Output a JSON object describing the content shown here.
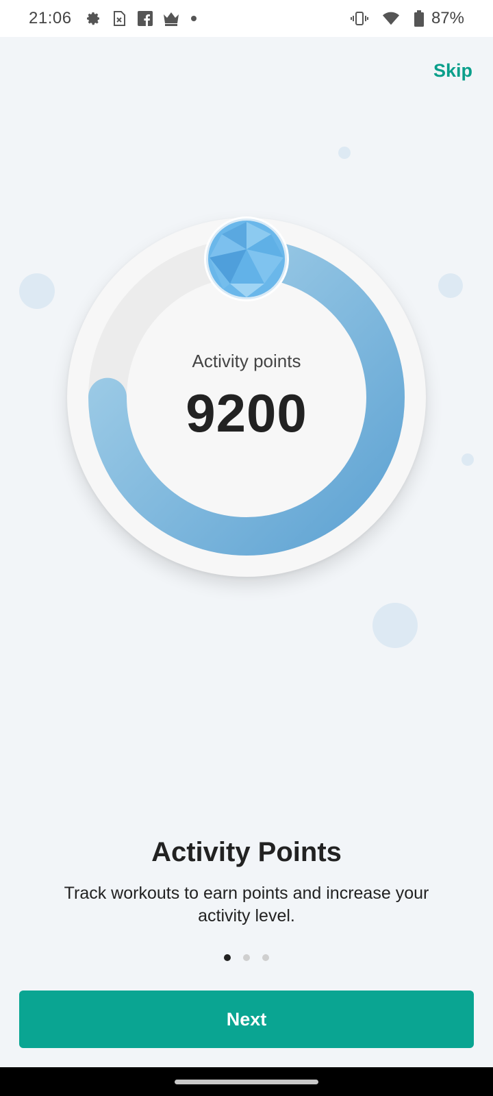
{
  "status_bar": {
    "time": "21:06",
    "left_icons": [
      "gear-icon",
      "sim-icon",
      "facebook-icon",
      "crown-icon",
      "dot-icon"
    ],
    "right_icons": [
      "vibrate-icon",
      "wifi-icon",
      "battery-icon"
    ],
    "battery": "87%"
  },
  "onboarding": {
    "skip_label": "Skip",
    "ring": {
      "label": "Activity points",
      "value": "9200",
      "progress_fraction": 0.75,
      "colors": {
        "track": "#ececec",
        "arc_start": "#a9d3ea",
        "arc_end": "#5fa3d3"
      }
    },
    "gem_icon": "blue-gem-icon",
    "title": "Activity Points",
    "description": "Track workouts to earn points and increase your activity level.",
    "pager": {
      "total": 3,
      "active": 0
    },
    "next_label": "Next"
  },
  "colors": {
    "accent": "#0aa592",
    "skip_text": "#0a9f8b",
    "background": "#f2f5f8"
  }
}
